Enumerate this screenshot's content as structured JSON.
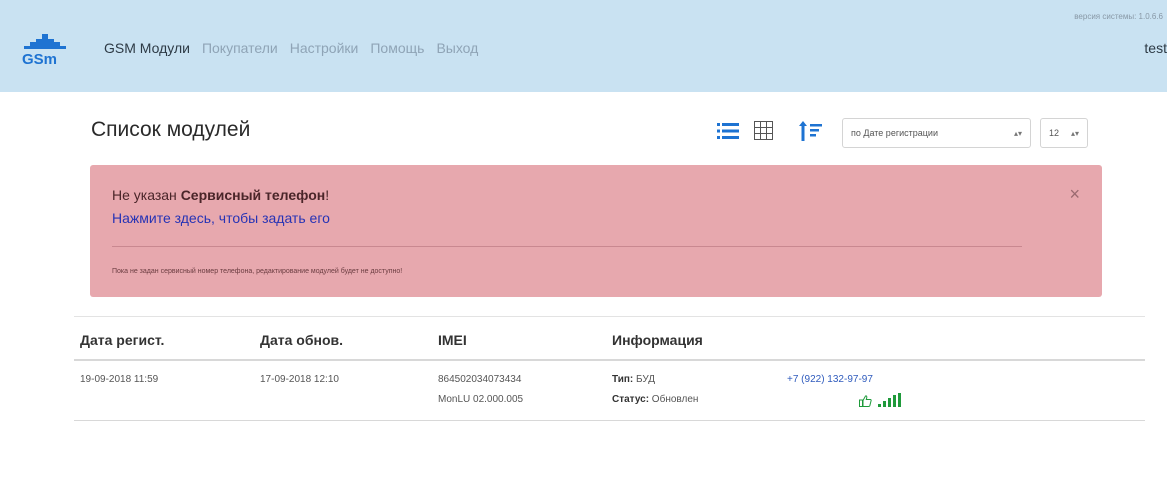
{
  "navbar": {
    "version": "версия системы: 1.0.6.6",
    "items": [
      {
        "label": "GSM Модули",
        "active": true
      },
      {
        "label": "Покупатели",
        "active": false
      },
      {
        "label": "Настройки",
        "active": false
      },
      {
        "label": "Помощь",
        "active": false
      },
      {
        "label": "Выход",
        "active": false
      }
    ],
    "user": "test"
  },
  "page": {
    "title": "Список модулей",
    "sort_select": "по Дате регистрации",
    "per_page_select": "12"
  },
  "alert": {
    "prefix": "Не указан ",
    "bold": "Сервисный телефон",
    "suffix": "!",
    "link": "Нажмите здесь, чтобы задать его",
    "note": "Пока не задан сервисный номер телефона, редактирование модулей будет не доступно!",
    "close": "×"
  },
  "table": {
    "headers": [
      "Дата регист.",
      "Дата обнов.",
      "IMEI",
      "Информация"
    ],
    "rows": [
      {
        "reg_date": "19-09-2018 11:59",
        "upd_date": "17-09-2018 12:10",
        "imei": "864502034073434",
        "firmware": "MonLU 02.000.005",
        "type_label": "Тип:",
        "type_value": " БУД",
        "status_label": "Статус:",
        "status_value": " Обновлен",
        "phone": "+7 (922) 132-97-97"
      }
    ]
  },
  "icons": {
    "list": "list-icon",
    "grid": "grid-icon",
    "sort": "sort-icon",
    "thumb": "thumbs-up-icon",
    "signal": "signal-icon"
  },
  "colors": {
    "navbar_bg": "#c9e2f2",
    "alert_bg": "#e7a8ae",
    "accent_blue": "#1e73d2",
    "link": "#2733b5",
    "signal_green": "#1f9a3b"
  }
}
